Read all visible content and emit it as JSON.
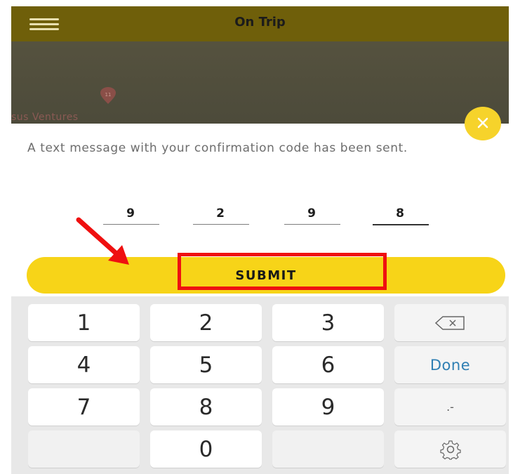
{
  "header": {
    "title": "On Trip",
    "menu_icon": "hamburger-menu-icon"
  },
  "map": {
    "place_label": "sus Ventures",
    "pin_icon": "map-pin-icon"
  },
  "dialog": {
    "close_icon": "close-icon",
    "message": "A text message with your confirmation code has been sent.",
    "code_digits": [
      "9",
      "2",
      "9",
      "8"
    ],
    "submit_label": "SUBMIT"
  },
  "keyboard": {
    "keys": [
      "1",
      "2",
      "3",
      "4",
      "5",
      "6",
      "7",
      "8",
      "9",
      "0"
    ],
    "done_label": "Done",
    "punct_label": ".-",
    "backspace_icon": "backspace-icon",
    "settings_icon": "settings-gear-icon"
  },
  "colors": {
    "header_bg": "#6f5f0a",
    "accent_yellow": "#f7d418",
    "annotation_red": "#ef1010",
    "done_blue": "#2f7fb3"
  }
}
